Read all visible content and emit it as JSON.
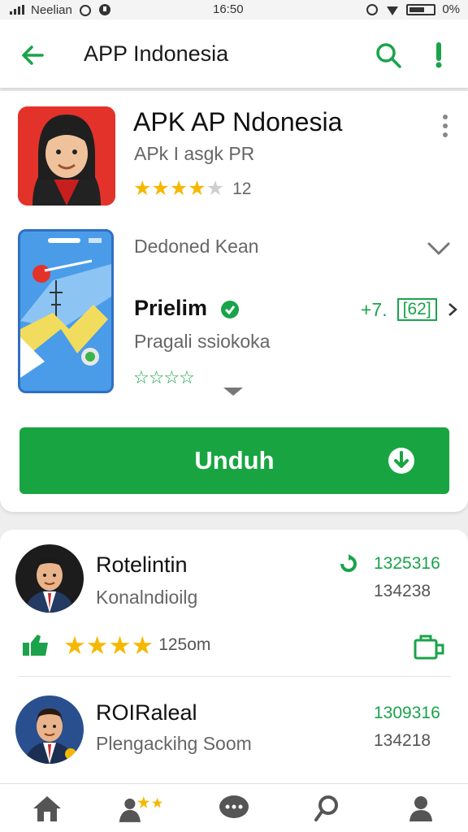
{
  "status_bar": {
    "carrier": "Neelian",
    "time": "16:50",
    "battery": "0%"
  },
  "app_bar": {
    "title": "APP Indonesia",
    "back_icon": "arrow-left-icon",
    "search_icon": "search-icon",
    "more_icon": "exclamation-icon"
  },
  "app": {
    "name": "APK AP Ndonesia",
    "subtitle": "APk I asgk PR",
    "rating_stars": 4,
    "rating_max": 5,
    "rating_count": "12",
    "star_color": "#f5b800"
  },
  "details": {
    "section_title": "Dedoned Kean",
    "premium_label": "Prielim",
    "premium_price": "+7.",
    "premium_price_box": "[62]",
    "premium_desc": "Pragali ssiokoka",
    "green_stars": "☆☆☆☆"
  },
  "download": {
    "label": "Unduh",
    "color": "#18a541"
  },
  "reviews": [
    {
      "name": "Rotelintin",
      "sub": "Konalndioilg",
      "num_a": "1325316",
      "num_b": "134238",
      "stars": 4,
      "time": "125om"
    },
    {
      "name": "ROIRaleal",
      "sub": "Plengackihg Soom",
      "num_a": "1309316",
      "num_b": "134218"
    }
  ],
  "bottom_nav": [
    {
      "icon": "home-icon"
    },
    {
      "icon": "people-stars-icon"
    },
    {
      "icon": "chat-icon"
    },
    {
      "icon": "search-icon"
    },
    {
      "icon": "profile-icon"
    }
  ],
  "accent": "#1aa34a"
}
